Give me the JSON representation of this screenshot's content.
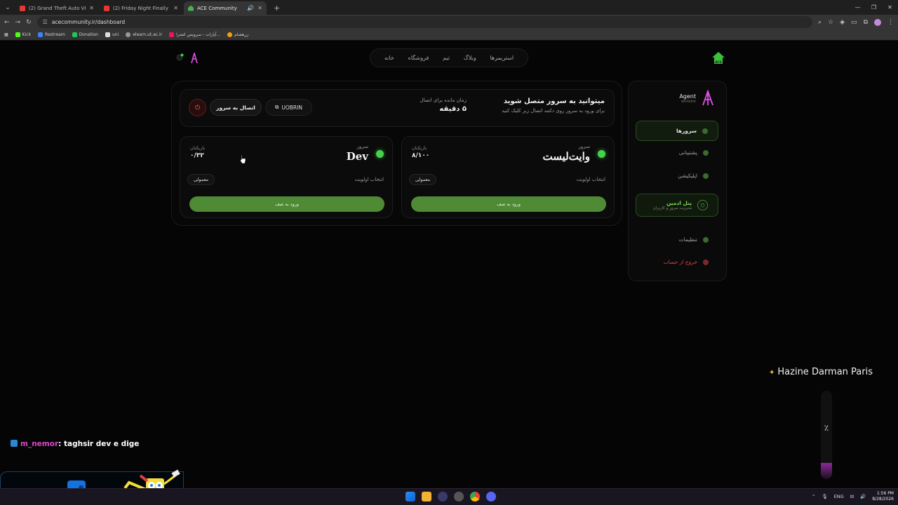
{
  "browser": {
    "tabs": [
      {
        "title": "(2) Grand Theft Auto VI: An Ent",
        "active": false
      },
      {
        "title": "(2) Friday Night Finally Feels Dif",
        "active": false
      },
      {
        "title": "ACE Community",
        "active": true
      }
    ],
    "url": "acecommunity.ir/dashboard",
    "bookmarks": [
      "Kick",
      "Restream",
      "Donation",
      "uni",
      "elearn.ut.ac.ir",
      "آپارات - سرویس اشترا...",
      "زرهشام"
    ]
  },
  "nav": {
    "items": [
      "خانه",
      "فروشگاه",
      "تیم",
      "وبلاگ",
      "استریمرها"
    ]
  },
  "sidebar": {
    "profile_name": "Agent",
    "profile_role": "whitelist",
    "items": {
      "servers": "سرورها",
      "support": "پشتیبانی",
      "application": "اپلیکیشن",
      "admin_title": "پنل ادمین",
      "admin_sub": "مدیریت سرور و کاربران",
      "settings": "تنظیمات",
      "logout": "خروج از حساب"
    }
  },
  "connect": {
    "title": "میتوانید به سرور متصل شوید",
    "subtitle": "برای ورود به سرور روی دکمه اتصال زیر کلیک کنید",
    "time_label": "زمان مانده برای اتصال",
    "time_value": "۵ دقیقه",
    "code": "UOBRIN",
    "connect_button": "اتصال به سرور"
  },
  "servers": [
    {
      "label": "سرور",
      "name": "وایت‌لیست",
      "players_label": "بازیکنان",
      "players": "۸/۱۰۰",
      "priority_label": "انتخاب اولویت",
      "priority_value": "معمولی",
      "join": "ورود به صف"
    },
    {
      "label": "سرور",
      "name": "Dev",
      "players_label": "بازیکنان",
      "players": "۰/۳۲",
      "priority_label": "انتخاب اولویت",
      "priority_value": "معمولی",
      "join": "ورود به صف"
    }
  ],
  "overlay": {
    "goal_title": "Hazine Darman Paris",
    "goal_percent_text": "٪",
    "goal_fill": 0.18,
    "chat_user": "m_nemor",
    "chat_message": ": taghsir dev e dige"
  },
  "taskbar": {
    "lang": "ENG",
    "time": "1:56 PM",
    "date": "8/28/2026"
  }
}
